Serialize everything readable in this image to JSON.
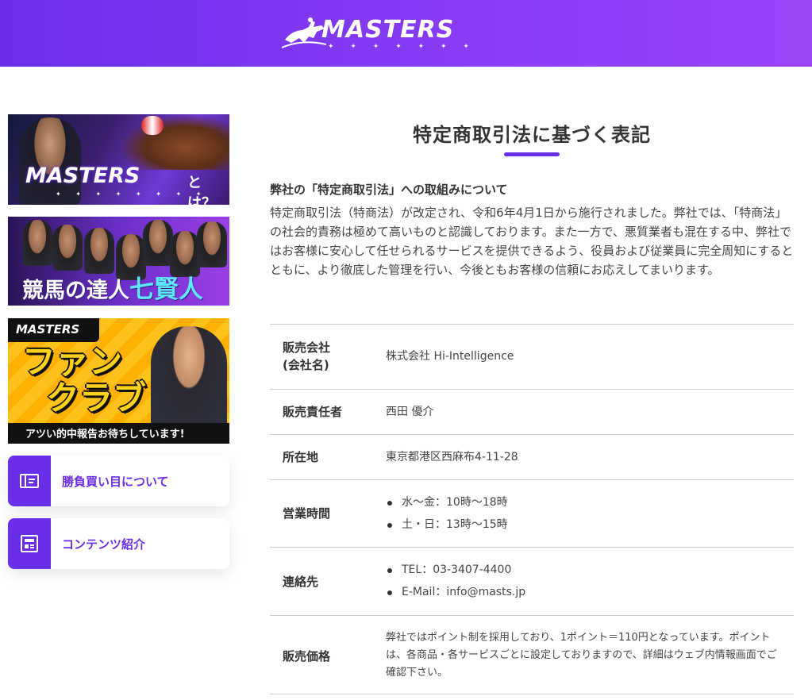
{
  "header": {
    "logo_text": "MASTERS",
    "logo_stars": "✦ ✦ ✦ ✦ ✦ ✦ ✦",
    "brand_color": "#6a2ee8"
  },
  "sidebar": {
    "banners": [
      {
        "text": "MASTERS",
        "suffix": "とは？",
        "stars": "✦ ✦ ✦ ✦ ✦ ✦ ✦ ✦"
      },
      {
        "text_prefix": "競馬の達人",
        "text_accent": "七賢人"
      },
      {
        "logo": "MASTERS",
        "title_line1": "ファン",
        "title_line2": "クラブ",
        "caption": "アツい的中報告お待ちしています!"
      }
    ],
    "menu": [
      {
        "label": "勝負買い目について",
        "icon": "ticket-icon"
      },
      {
        "label": "コンテンツ紹介",
        "icon": "newspaper-icon"
      }
    ]
  },
  "main": {
    "title": "特定商取引法に基づく表記",
    "intro_heading": "弊社の「特定商取引法」への取組みについて",
    "intro_body": "特定商取引法（特商法）が改定され、令和6年4月1日から施行されました。弊社では、「特商法」の社会的責務は極めて高いものと認識しております。また一方で、悪質業者も混在する中、弊社ではお客様に安心して任せられるサービスを提供できるよう、役員および従業員に完全周知にするとともに、より徹底した管理を行い、今後ともお客様の信頼にお応えしてまいります。",
    "rows": [
      {
        "label_line1": "販売会社",
        "label_line2": "(会社名)",
        "value": "株式会社 Hi-Intelligence"
      },
      {
        "label": "販売責任者",
        "value": "西田 優介"
      },
      {
        "label": "所在地",
        "value": "東京都港区西麻布4-11-28"
      },
      {
        "label": "営業時間",
        "items": [
          "水～金：10時～18時",
          "土・日：13時～15時"
        ]
      },
      {
        "label": "連絡先",
        "items": [
          "TEL：03-3407-4400",
          "E-Mail：info@masts.jp"
        ]
      },
      {
        "label": "販売価格",
        "value": "弊社ではポイント制を採用しており、1ポイント＝110円となっています。ポイントは、各商品・各サービスごとに設定しておりますので、詳細はウェブ内情報画面でご確認下さい。"
      }
    ]
  }
}
